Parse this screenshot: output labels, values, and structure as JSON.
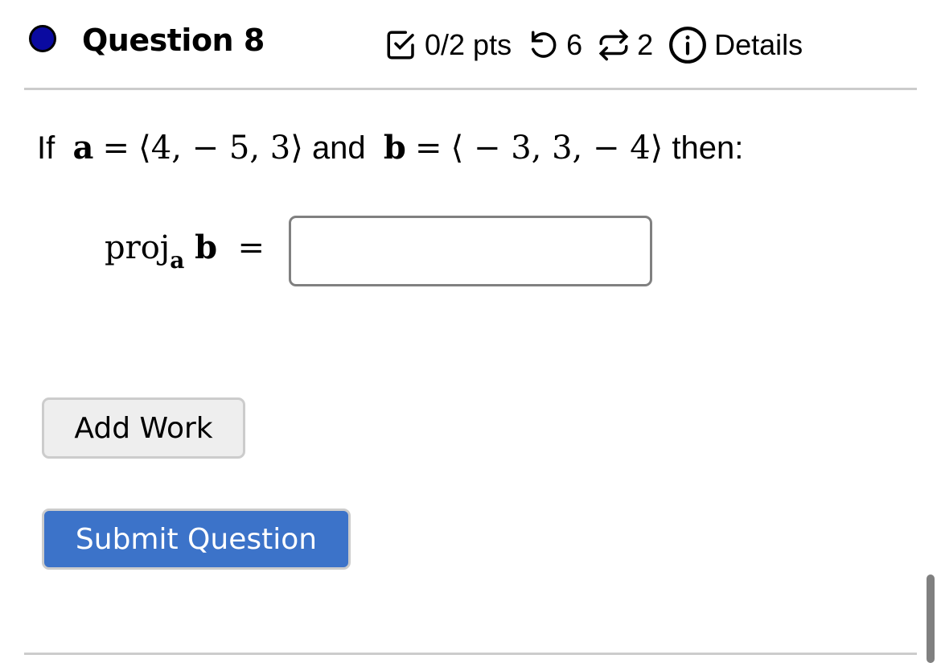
{
  "header": {
    "question_title": "Question 8",
    "status_color": "#0a0aa0",
    "points": "0/2 pts",
    "attempts_remaining": "6",
    "versions": "2",
    "details_label": "Details",
    "icons": [
      "checkbox-check-icon",
      "undo-icon",
      "repeat-icon",
      "info-icon"
    ]
  },
  "problem": {
    "prefix": "If",
    "vec_a_name": "a",
    "equals": "=",
    "vec_a_value": "⟨4,  − 5, 3⟩",
    "conj": "and",
    "vec_b_name": "b",
    "vec_b_value": "⟨ − 3, 3,  − 4⟩",
    "suffix": "then:"
  },
  "answer": {
    "label_proj": "proj",
    "label_sub": "a",
    "label_vec": "b",
    "label_equals": "=",
    "value": "",
    "placeholder": ""
  },
  "buttons": {
    "add_work": "Add Work",
    "submit": "Submit Question",
    "submit_color": "#3c73c9"
  }
}
